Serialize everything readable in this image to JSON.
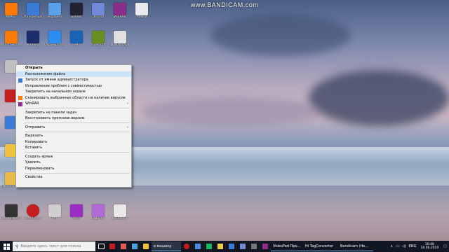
{
  "watermark": "www.BANDICAM.com",
  "desktop": {
    "icons": [
      {
        "id": "i1",
        "label": "AVAST",
        "color": "#ff7a00"
      },
      {
        "id": "i2",
        "label": "Эта компьютер",
        "color": "#3a7bd5"
      },
      {
        "id": "i3",
        "label": "Корзина",
        "color": "#5aa0e8"
      },
      {
        "id": "i4",
        "label": "Steam",
        "color": "#223"
      },
      {
        "id": "i5",
        "label": "Discord",
        "color": "#7289da"
      },
      {
        "id": "i6",
        "label": "WinRAR",
        "color": "#8b2d8b"
      },
      {
        "id": "i7",
        "label": "Новый",
        "color": "#eaeaea"
      },
      {
        "id": "i8",
        "label": "Avast SecureLine",
        "color": "#ff7a00"
      },
      {
        "id": "i9",
        "label": "Кликер",
        "color": "#1b2d6b"
      },
      {
        "id": "i10",
        "label": "Скриншотер",
        "color": "#2d8cf0"
      },
      {
        "id": "i11",
        "label": "FAR",
        "color": "#1a64b4"
      },
      {
        "id": "i12",
        "label": "minecraft",
        "color": "#6b8e23"
      },
      {
        "id": "i13",
        "label": "Файлы Java",
        "color": "#e0e0e0"
      },
      {
        "id": "i14",
        "label": "Counter-Strike",
        "color": "#c0c0c0"
      },
      {
        "id": "i15",
        "label": "Без названия",
        "color": "#333"
      },
      {
        "id": "i16",
        "label": "Bandicam",
        "color": "#c41e1e"
      },
      {
        "id": "i17",
        "label": "ffff",
        "color": "#cfcfcf"
      },
      {
        "id": "i18",
        "label": "поот",
        "color": "#9a2dc4"
      },
      {
        "id": "i19",
        "label": "ОЦЕНКИ",
        "color": "#b06ad6"
      },
      {
        "id": "i20",
        "label": "boxbackw",
        "color": "#e8e8e8"
      },
      {
        "id": "i21",
        "label": "Downloads",
        "color": "#f0c040"
      }
    ]
  },
  "context_menu": {
    "items": [
      {
        "label": "Открыть",
        "bold": true,
        "icon": "none"
      },
      {
        "label": "Расположение файла",
        "icon": "none",
        "hover": true
      },
      {
        "label": "Запуск от имени администратора",
        "icon": "shield-icon"
      },
      {
        "label": "Исправление проблем с совместимостью",
        "icon": "none"
      },
      {
        "label": "Закрепить на начальном экране",
        "icon": "none"
      },
      {
        "label": "Сканировать выбранные области на наличие вирусов",
        "icon": "avast-icon"
      },
      {
        "label": "WinRAR",
        "icon": "winrar-icon",
        "submenu": true
      },
      {
        "sep": true
      },
      {
        "label": "Закрепить на панели задач",
        "icon": "none"
      },
      {
        "label": "Восстановить прежнюю версию",
        "icon": "none"
      },
      {
        "sep": true
      },
      {
        "label": "Отправить",
        "icon": "none",
        "submenu": true
      },
      {
        "sep": true
      },
      {
        "label": "Вырезать",
        "icon": "none"
      },
      {
        "label": "Копировать",
        "icon": "none"
      },
      {
        "label": "Вставить",
        "icon": "none"
      },
      {
        "sep": true
      },
      {
        "label": "Создать ярлык",
        "icon": "none"
      },
      {
        "label": "Удалить",
        "icon": "none"
      },
      {
        "label": "Переименовать",
        "icon": "none"
      },
      {
        "sep": true
      },
      {
        "label": "Свойства",
        "icon": "none"
      }
    ]
  },
  "taskbar": {
    "search_placeholder": "Введите здесь текст для поиска",
    "pinned_label": "в машину",
    "windows": [
      {
        "label": "VideoPad Про..."
      },
      {
        "label": "Hi TagConverter"
      },
      {
        "label": "Bandicam (Не..."
      }
    ],
    "language": "ENG",
    "time": "10:48",
    "date": "18.06.2019"
  }
}
